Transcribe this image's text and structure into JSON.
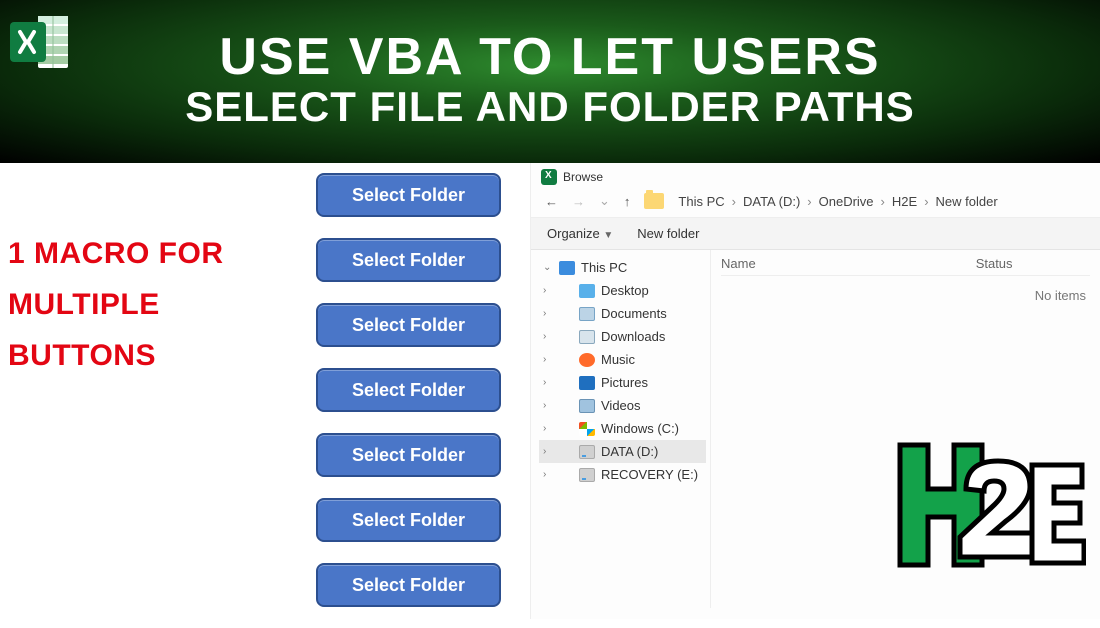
{
  "header": {
    "title_line1": "USE VBA TO LET USERS",
    "title_line2": "SELECT FILE AND FOLDER PATHS"
  },
  "left_note": {
    "line1": "1 MACRO FOR",
    "line2": "MULTIPLE",
    "line3": "BUTTONS"
  },
  "buttons": {
    "label": "Select Folder",
    "count": 7
  },
  "browser": {
    "window_title": "Browse",
    "nav": {
      "back": "←",
      "forward": "→",
      "up": "↑"
    },
    "breadcrumbs": [
      "This PC",
      "DATA (D:)",
      "OneDrive",
      "H2E",
      "New folder"
    ],
    "toolbar": {
      "organize": "Organize",
      "newfolder": "New folder"
    },
    "list": {
      "col_name": "Name",
      "col_status": "Status",
      "empty": "No items"
    },
    "tree": [
      {
        "label": "This PC",
        "icon": "i-pc",
        "level": 0,
        "caret": "v",
        "selected": false
      },
      {
        "label": "Desktop",
        "icon": "i-desk",
        "level": 1,
        "caret": ">",
        "selected": false
      },
      {
        "label": "Documents",
        "icon": "i-doc",
        "level": 1,
        "caret": ">",
        "selected": false
      },
      {
        "label": "Downloads",
        "icon": "i-down",
        "level": 1,
        "caret": ">",
        "selected": false
      },
      {
        "label": "Music",
        "icon": "i-music",
        "level": 1,
        "caret": ">",
        "selected": false
      },
      {
        "label": "Pictures",
        "icon": "i-pic",
        "level": 1,
        "caret": ">",
        "selected": false
      },
      {
        "label": "Videos",
        "icon": "i-vid",
        "level": 1,
        "caret": ">",
        "selected": false
      },
      {
        "label": "Windows (C:)",
        "icon": "i-win",
        "level": 1,
        "caret": ">",
        "selected": false
      },
      {
        "label": "DATA (D:)",
        "icon": "i-drive",
        "level": 1,
        "caret": ">",
        "selected": true
      },
      {
        "label": "RECOVERY (E:)",
        "icon": "i-drive",
        "level": 1,
        "caret": ">",
        "selected": false
      }
    ]
  },
  "logo": {
    "alt": "H2E"
  }
}
